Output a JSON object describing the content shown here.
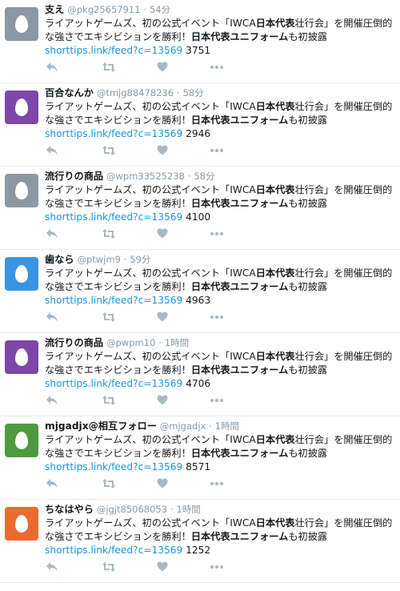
{
  "tweet_common": {
    "text_plain_1": "ライアットゲームズ、初の公式イベント「IWCA",
    "text_bold_1": "日本代表",
    "text_plain_2": "壮行会」を開催圧倒的な強さでエキシビションを勝利！",
    "text_bold_2": "日本代表ユニフォーム",
    "text_plain_3": "も初披露",
    "link": "shorttips.link/feed?c=13569",
    "dot": "·"
  },
  "tweets": [
    {
      "name": "支え",
      "handle": "@pkg25657911",
      "time": "54分",
      "count": "3751",
      "avatar_color": "#8b98a3"
    },
    {
      "name": "百合なんか",
      "handle": "@tmjg88478236",
      "time": "58分",
      "count": "2946",
      "avatar_color": "#7d47a8"
    },
    {
      "name": "流行りの商品",
      "handle": "@wpm33525238",
      "time": "58分",
      "count": "4100",
      "avatar_color": "#8b98a3"
    },
    {
      "name": "歯なら",
      "handle": "@ptwjm9",
      "time": "59分",
      "count": "4963",
      "avatar_color": "#3b94e0"
    },
    {
      "name": "流行りの商品",
      "handle": "@pwpm10",
      "time": "1時間",
      "count": "4706",
      "avatar_color": "#7d47a8"
    },
    {
      "name": "mjgadjx@相互フォロー",
      "handle": "@mjgadjx",
      "time": "1時間",
      "count": "8571",
      "avatar_color": "#4e9a3f"
    },
    {
      "name": "ちなはやら",
      "handle": "@jgjt85068053",
      "time": "1時間",
      "count": "1252",
      "avatar_color": "#e96b30"
    }
  ],
  "icons": {
    "reply": "reply-icon",
    "retweet": "retweet-icon",
    "like": "heart-icon",
    "more": "more-icon"
  },
  "colors": {
    "link": "#1b95e0",
    "meta": "#8899a6",
    "icon": "#aab8c2",
    "divider": "#e6ecf0"
  }
}
